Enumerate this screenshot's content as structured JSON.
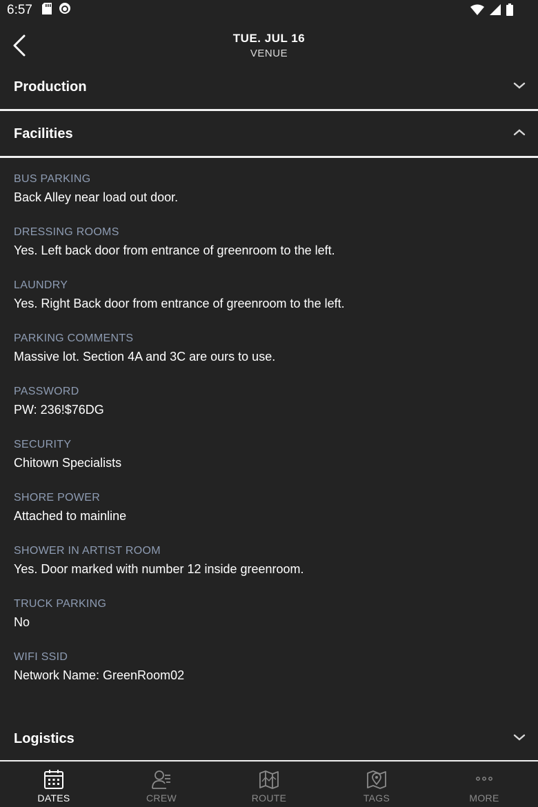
{
  "status_bar": {
    "time": "6:57",
    "icons_left": [
      "sd-card-icon",
      "notification-icon"
    ],
    "icons_right": [
      "wifi-icon",
      "signal-icon",
      "battery-icon"
    ]
  },
  "header": {
    "title": "TUE. JUL 16",
    "subtitle": "VENUE"
  },
  "sections": {
    "production": {
      "label": "Production",
      "expanded": false
    },
    "facilities": {
      "label": "Facilities",
      "expanded": true
    },
    "logistics": {
      "label": "Logistics",
      "expanded": false
    }
  },
  "facilities_fields": [
    {
      "label": "BUS PARKING",
      "value": "Back Alley near load out door."
    },
    {
      "label": "DRESSING ROOMS",
      "value": "Yes. Left back door from entrance of greenroom to the left."
    },
    {
      "label": "LAUNDRY",
      "value": "Yes. Right Back door from entrance of greenroom to the left."
    },
    {
      "label": "PARKING COMMENTS",
      "value": "Massive lot. Section 4A and 3C are ours to use."
    },
    {
      "label": "PASSWORD",
      "value": "PW: 236!$76DG"
    },
    {
      "label": "SECURITY",
      "value": "Chitown Specialists"
    },
    {
      "label": "SHORE POWER",
      "value": "Attached to mainline"
    },
    {
      "label": "SHOWER IN ARTIST ROOM",
      "value": "Yes. Door marked with number 12 inside greenroom."
    },
    {
      "label": "TRUCK PARKING",
      "value": "No"
    },
    {
      "label": "WIFI SSID",
      "value": "Network Name: GreenRoom02"
    }
  ],
  "bottom_nav": [
    {
      "label": "DATES",
      "icon": "calendar-icon",
      "active": true
    },
    {
      "label": "CREW",
      "icon": "crew-icon",
      "active": false
    },
    {
      "label": "ROUTE",
      "icon": "map-icon",
      "active": false
    },
    {
      "label": "TAGS",
      "icon": "map-pin-icon",
      "active": false
    },
    {
      "label": "MORE",
      "icon": "more-icon",
      "active": false
    }
  ],
  "colors": {
    "background": "#232323",
    "label": "#8e9cb3",
    "divider": "#f0f0f0",
    "nav_inactive": "#8a8a8a"
  }
}
